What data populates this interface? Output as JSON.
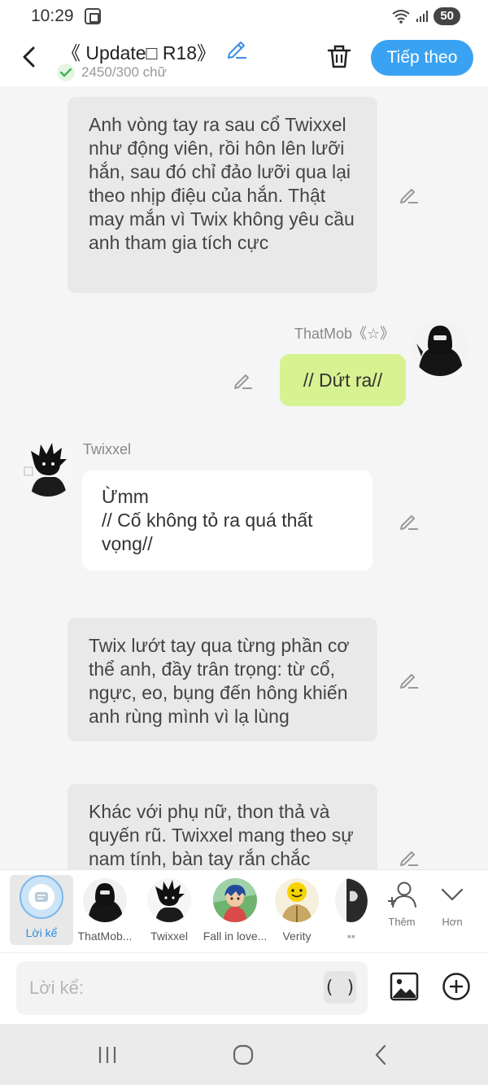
{
  "status": {
    "time": "10:29",
    "battery": "50"
  },
  "header": {
    "title": "《 Update□ R18》",
    "word_count": "2450/300 chữ",
    "next_label": "Tiếp theo"
  },
  "messages": [
    {
      "type": "narration",
      "text": "Anh vòng tay ra sau cổ Twixxel như động viên, rồi hôn lên lưỡi hắn, sau đó chỉ đảo lưỡi qua lại theo nhịp điệu của hắn. Thật may mắn vì Twix không yêu cầu anh tham gia tích cực"
    },
    {
      "type": "right",
      "name": "ThatMob《☆》",
      "text": "// Dứt ra//"
    },
    {
      "type": "left",
      "name": "Twixxel",
      "line1": "Ừmm",
      "line2": "// Cố không tỏ ra quá thất vọng//"
    },
    {
      "type": "narration",
      "text": "Twix lướt tay qua từng phần cơ thể anh, đầy trân trọng: từ cổ, ngực, eo, bụng đến hông khiến anh rùng mình vì lạ lùng"
    },
    {
      "type": "narration",
      "text": "Khác với phụ nữ, thon thả và quyến rũ. Twixxel mang theo sự nam tính, bàn tay rắn chắc"
    }
  ],
  "characters": [
    {
      "label": "Lời kể",
      "icon": "narration-icon"
    },
    {
      "label": "ThatMob...",
      "icon": "dark-hood-avatar"
    },
    {
      "label": "Twixxel",
      "icon": "spiky-hair-avatar"
    },
    {
      "label": "Fall in love...",
      "icon": "blue-hair-avatar"
    },
    {
      "label": "Verity",
      "icon": "yellow-smiley-avatar"
    },
    {
      "label": "▪▪",
      "icon": "mask-avatar"
    }
  ],
  "tools": {
    "add_label": "Thêm",
    "more_label": "Hơn"
  },
  "composer": {
    "placeholder": "Lời kể:",
    "paren_label": "( )"
  },
  "colors": {
    "accent": "#3aa2f2",
    "green_bubble": "#d7f291",
    "narration_bubble": "#e9e9e9"
  }
}
